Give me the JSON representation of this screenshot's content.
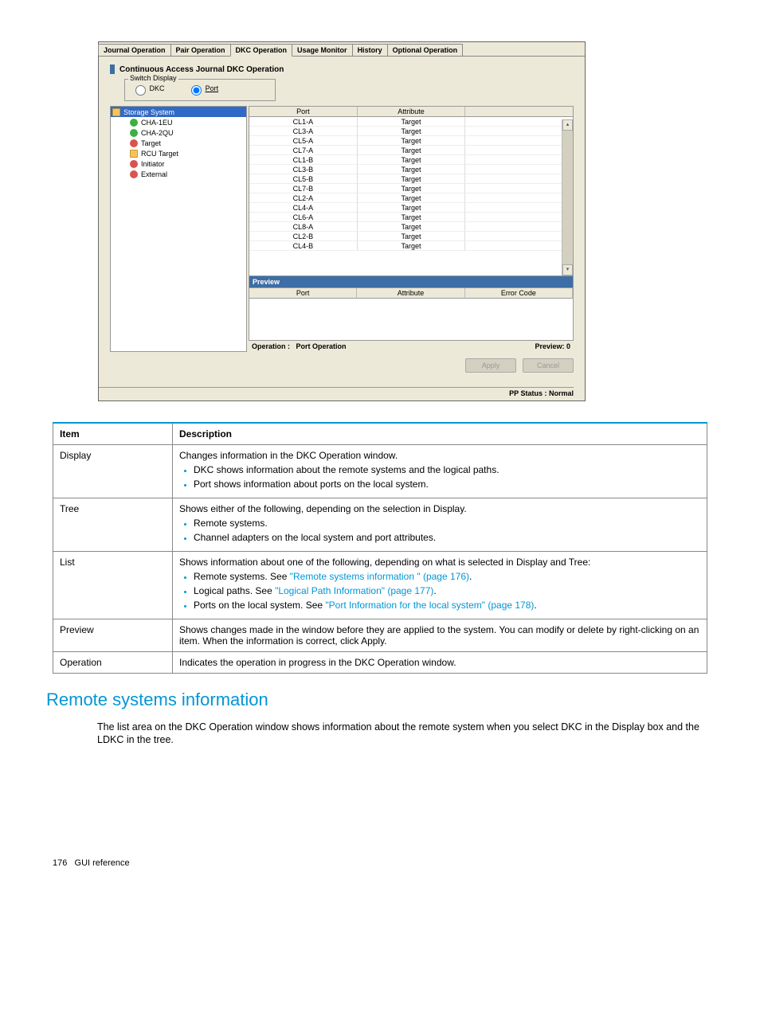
{
  "tabs": [
    "Journal Operation",
    "Pair Operation",
    "DKC Operation",
    "Usage Monitor",
    "History",
    "Optional Operation"
  ],
  "active_tab": 2,
  "panel_title": "Continuous Access Journal DKC Operation",
  "switch_display": {
    "legend": "Switch Display",
    "dkc_label": "DKC",
    "port_label": "Port"
  },
  "tree": {
    "root": "Storage System",
    "items": [
      {
        "label": "CHA-1EU",
        "icon": "green"
      },
      {
        "label": "CHA-2QU",
        "icon": "green"
      },
      {
        "label": "Target",
        "icon": "red"
      },
      {
        "label": "RCU Target",
        "icon": "folder"
      },
      {
        "label": "Initiator",
        "icon": "red"
      },
      {
        "label": "External",
        "icon": "red"
      }
    ]
  },
  "port_table": {
    "headers": [
      "Port",
      "Attribute",
      ""
    ],
    "rows": [
      [
        "CL1-A",
        "Target",
        ""
      ],
      [
        "CL3-A",
        "Target",
        ""
      ],
      [
        "CL5-A",
        "Target",
        ""
      ],
      [
        "CL7-A",
        "Target",
        ""
      ],
      [
        "CL1-B",
        "Target",
        ""
      ],
      [
        "CL3-B",
        "Target",
        ""
      ],
      [
        "CL5-B",
        "Target",
        ""
      ],
      [
        "CL7-B",
        "Target",
        ""
      ],
      [
        "CL2-A",
        "Target",
        ""
      ],
      [
        "CL4-A",
        "Target",
        ""
      ],
      [
        "CL6-A",
        "Target",
        ""
      ],
      [
        "CL8-A",
        "Target",
        ""
      ],
      [
        "CL2-B",
        "Target",
        ""
      ],
      [
        "CL4-B",
        "Target",
        ""
      ]
    ]
  },
  "preview_label": "Preview",
  "preview_headers": [
    "Port",
    "Attribute",
    "Error Code"
  ],
  "operation_label": "Operation :",
  "operation_value": "Port Operation",
  "preview_count_label": "Preview:",
  "preview_count": "0",
  "apply_label": "Apply",
  "cancel_label": "Cancel",
  "pp_status": "PP Status : Normal",
  "desc_headers": [
    "Item",
    "Description"
  ],
  "desc_rows": {
    "display": {
      "item": "Display",
      "intro": "Changes information in the DKC Operation window.",
      "bullets": [
        "DKC shows information about the remote systems and the logical paths.",
        "Port shows information about ports on the local system."
      ]
    },
    "tree": {
      "item": "Tree",
      "intro": "Shows either of the following, depending on the selection in Display.",
      "bullets": [
        "Remote systems.",
        "Channel adapters on the local system and port attributes."
      ]
    },
    "list": {
      "item": "List",
      "intro": "Shows information about one of the following, depending on what is selected in Display and Tree:",
      "b1_pre": "Remote systems. See ",
      "b1_link": "\"Remote systems information \" (page 176)",
      "b2_pre": "Logical paths. See ",
      "b2_link": "\"Logical Path Information\" (page 177)",
      "b3_pre": "Ports on the local system. See ",
      "b3_link": "\"Port Information for the local system\" (page 178)"
    },
    "preview": {
      "item": "Preview",
      "text": "Shows changes made in the window before they are applied to the system. You can modify or delete by right-clicking on an item. When the information is correct, click Apply."
    },
    "operation": {
      "item": "Operation",
      "text": "Indicates the operation in progress in the DKC Operation window."
    }
  },
  "section_heading": "Remote systems information",
  "section_body": "The list area on the DKC Operation window shows information about the remote system when you select DKC in the Display box and the LDKC in the tree.",
  "footer_page": "176",
  "footer_text": "GUI reference"
}
